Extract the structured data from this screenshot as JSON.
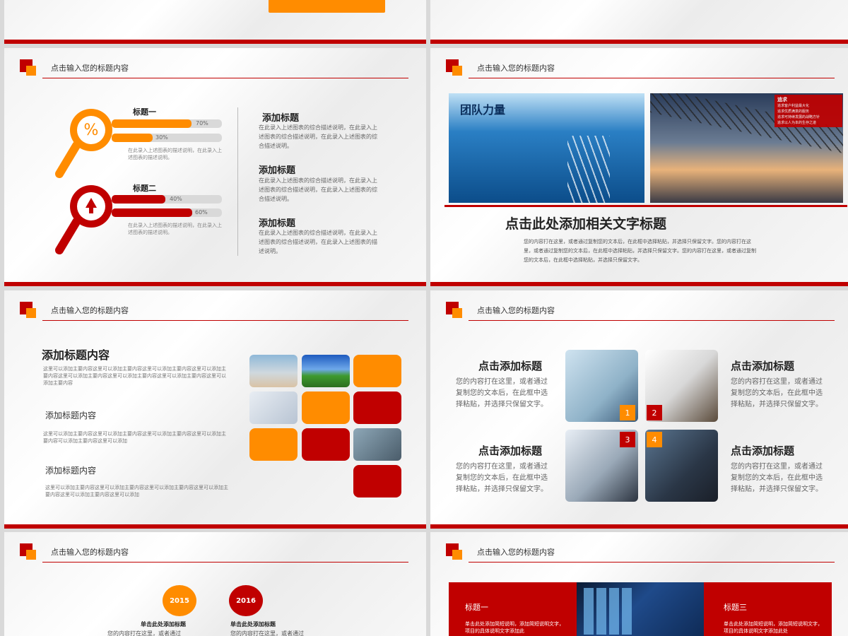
{
  "header_title": "点击输入您的标题内容",
  "slide2": {
    "items": [
      {
        "title": "标题一",
        "bar1": "70%",
        "bar2": "30%",
        "bar1_value": 70,
        "bar2_value": 30,
        "desc": "在此录入上述图表的描述说明，在此录入上述图表的描述说明。"
      },
      {
        "title": "标题二",
        "bar1": "40%",
        "bar2": "60%",
        "bar1_value": 40,
        "bar2_value": 60,
        "desc": "在此录入上述图表的描述说明，在此录入上述图表的描述说明。"
      }
    ],
    "right": [
      {
        "title": "添加标题",
        "body": "在此录入上述图表的综合描述说明，在此录入上述图表的综合描述说明，在此录入上述图表的综合描述说明。"
      },
      {
        "title": "添加标题",
        "body": "在此录入上述图表的综合描述说明，在此录入上述图表的综合描述说明，在此录入上述图表的综合描述说明。"
      },
      {
        "title": "添加标题",
        "body": "在此录入上述图表的综合描述说明，在此录入上述图表的综合描述说明，在此录入上述图表的描述说明。"
      }
    ]
  },
  "slide3": {
    "photo_title": "团队力量",
    "photo_caption": "追求",
    "photo_bullets": [
      "追求客户利益最大化",
      "追求优质满意的服务",
      "追求可持续发展的战略方针",
      "追求以人为本的生存之道"
    ],
    "title": "点击此处添加相关文字标题",
    "body": "您的内容打在这里，或者通过复制您的文本后，在此框中选择粘贴，并选择只保留文字。您的内容打在这里，或者通过复制您的文本后，在此框中选择粘贴，并选择只保留文字。您的内容打在这里，或者通过复制您的文本后，在此框中选择粘贴，并选择只保留文字。"
  },
  "slide4": {
    "main_title": "添加标题内容",
    "main_body": "这里可以添加主要内容这里可以添加主要内容这里可以添加主要内容这里可以添加主要内容这里可以添加主要内容这里可以添加主要内容这里可以添加主要内容这里可以添加主要内容",
    "sub1_title": "添加标题内容",
    "sub1_body": "这里可以添加主要内容这里可以添加主要内容这里可以添加主要内容这里可以添加主要内容可以添加主要内容这里可以添加",
    "sub2_title": "添加标题内容",
    "sub2_body": "这里可以添加主要内容这里可以添加主要内容这里可以添加主要内容这里可以添加主要内容这里可以添加主要内容这里可以添加"
  },
  "slide5": {
    "items": [
      {
        "title": "点击添加标题",
        "body": "您的内容打在这里，或者通过复制您的文本后，在此框中选择粘贴，并选择只保留文字。",
        "num": "1"
      },
      {
        "title": "点击添加标题",
        "body": "您的内容打在这里，或者通过复制您的文本后，在此框中选择粘贴，并选择只保留文字。",
        "num": "2"
      },
      {
        "title": "点击添加标题",
        "body": "您的内容打在这里，或者通过复制您的文本后，在此框中选择粘贴，并选择只保留文字。",
        "num": "3"
      },
      {
        "title": "点击添加标题",
        "body": "您的内容打在这里，或者通过复制您的文本后，在此框中选择粘贴，并选择只保留文字。",
        "num": "4"
      }
    ]
  },
  "slide6": {
    "years": [
      "2015",
      "2016"
    ],
    "item_title": "单击此处添加标题",
    "item_body": "您的内容打在这里，或者通过"
  },
  "slide7": {
    "left_title": "标题一",
    "left_body": "单击此处添加简短说明，添加简短说明文字，项目的具体说明文字添加此",
    "right_title": "标题三",
    "right_body": "单击此处添加简短说明，添加简短说明文字，项目的具体说明文字添加此处"
  },
  "colors": {
    "red": "#c00000",
    "orange": "#ff8c00"
  }
}
